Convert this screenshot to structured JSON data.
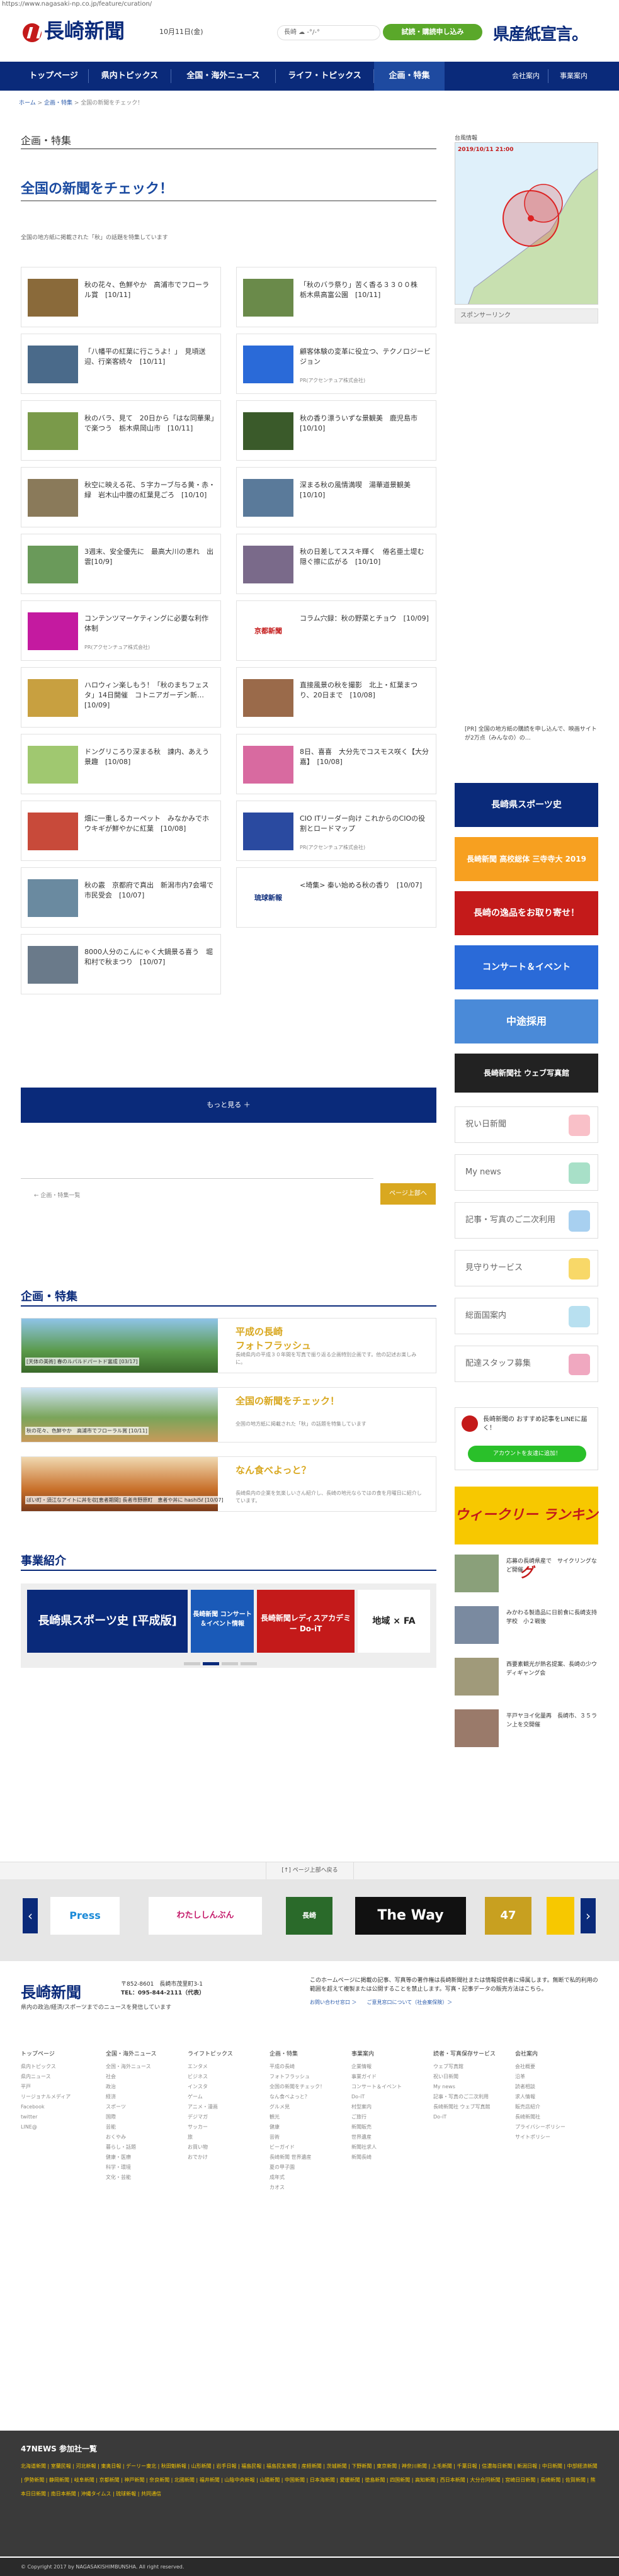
{
  "browser": {
    "url": "https://www.nagasaki-np.co.jp/feature/curation/"
  },
  "header": {
    "logo": "長崎新聞",
    "date": "10月11日(金)",
    "weather": "長崎 ☁ -°/-°",
    "trial": "試読・購読申し込み",
    "kensan": "県産紙宣言。"
  },
  "nav": {
    "items": [
      "トップページ",
      "県内トピックス",
      "全国・海外ニュース",
      "ライフ・トピックス",
      "企画・特集"
    ],
    "right": [
      "会社案内",
      "事業案内"
    ]
  },
  "breadcrumb": {
    "home": "ホーム",
    "sep": " > ",
    "mid": "企画・特集",
    "current": "全国の新聞をチェック！"
  },
  "section_heading": "企画・特集",
  "page_title": "全国の新聞をチェック！",
  "lead": "全国の地方紙に掲載された「秋」の話題を特集しています",
  "articles": [
    {
      "title": "秋の花々、色鮮やか　高浦市でフローラル賞　[10/11]",
      "pr": ""
    },
    {
      "title": "「秋のバラ祭り」苦く香る３３００株　栃木県高富公園　[10/11]",
      "pr": ""
    },
    {
      "title": "「八幡平の紅葉に行こうよ！」　見頃送迎、行楽客続々　[10/11]",
      "pr": ""
    },
    {
      "title": "顧客体験の変革に役立つ、テクノロジービジョン",
      "pr": "PR(アクセンチュア株式会社)"
    },
    {
      "title": "秋のバラ、見て　20日から「はな同華果」で楽つう　栃木県岡山市　[10/11]",
      "pr": ""
    },
    {
      "title": "秋の香り漂ういずな景観美　鹿児島市　[10/10]",
      "pr": ""
    },
    {
      "title": "秋空に映える花、５字カーブ与る黄・赤・緑　岩木山中腹の紅葉見ごろ　[10/10]",
      "pr": ""
    },
    {
      "title": "深まる秋の風情満喫　湯華道景観美　[10/10]",
      "pr": ""
    },
    {
      "title": "3週末、安全優先に　最高大川の恵れ　出雲[10/9]",
      "pr": ""
    },
    {
      "title": "秋の日差してススキ輝く　倦名亜土堤む隠ぐ擦に広がる　[10/10]",
      "pr": ""
    },
    {
      "title": "コンテンツマーケティングに必要な利作体制",
      "pr": "PR(アクセンチュア株式会社)"
    },
    {
      "title": "コラム穴録：秋の野菜とチョウ　[10/09]",
      "pr": ""
    },
    {
      "title": "ハロウィン楽しもう！「秋のまちフェスタ」14日開催　コトニアガーデン新…[10/09]",
      "pr": ""
    },
    {
      "title": "直接風景の秋を撮影　北上・紅葉まつり、20日まで　[10/08]",
      "pr": ""
    },
    {
      "title": "ドングリころり深まる秋　諫内、あえう景趣　[10/08]",
      "pr": ""
    },
    {
      "title": "8日、喜喜　大分先でコスモス咲く【大分嘉】　[10/08]",
      "pr": ""
    },
    {
      "title": "畑に一重しるカーペット　みなかみでホウキギが鮮やかに紅葉　[10/08]",
      "pr": ""
    },
    {
      "title": "CIO ITリーダー向け これからのCIOの役割とロードマップ",
      "pr": "PR(アクセンチュア株式会社)"
    },
    {
      "title": "秋の霰　京都府で真出　新潟市内7会場で市民受会　[10/07]",
      "pr": ""
    },
    {
      "title": "<埼集> 秦い始める秋の香り　[10/07]",
      "pr": ""
    },
    {
      "title": "8000人分のこんにゃく大鍋景る喜う　堀和村で秋まつり　[10/07]",
      "pr": ""
    }
  ],
  "pr_logos": {
    "kyodo": "京都新聞",
    "ryukyu": "琉球新報"
  },
  "more_button": "もっと見る ＋",
  "pager": {
    "prev": "← 企画・特集一覧",
    "next": "ページ上部へ"
  },
  "features_heading": "企画・特集",
  "features": [
    {
      "caption": "[天体の美術] 春のルパルドパートド富成 [03/17]",
      "title_line1": "平成の長崎",
      "title_line2": "フォトフラッシュ",
      "desc": "長崎県内の平成３０年間を写真で振り返る企画特別企画です。他の記述お楽しみに。"
    },
    {
      "caption": "秋の花々、色鮮やか　高浦市でフローラル賞 [10/11]",
      "title_line1": "全国の新聞をチェック！",
      "title_line2": "",
      "desc": "全国の地方紙に掲載された「秋」の話題を特集しています"
    },
    {
      "caption": "ぼい町・須江なアイトに丼を収[恵者期間] 長者市野原町　恵者や丼に hashi5ℓ [10/07]",
      "title_line1": "なん食べよっと？",
      "title_line2": "",
      "desc": "長崎県内の企業を気楽しいさん紹介し、長崎の地元ならではの食を月曜日に紹介しています。"
    }
  ],
  "business_heading": "事業紹介",
  "business_banners": [
    "長崎県スポーツ史 [平成版]",
    "長崎新聞 コンサート＆イベント情報",
    "長崎新聞レディスアカデミー Do-iT",
    "地域 × FA"
  ],
  "sidebar": {
    "map_label": "台風情報",
    "map_caption": "2019/10/11 21:00",
    "sponsor": "スポンサーリンク",
    "pr_text": "[PR] 全国の地方紙の購読を申し込んで、映画サイトが2万点（みんなの）の…",
    "banners": [
      "長崎県スポーツ史",
      "長崎新聞 高校総体 三寺寺大 2019",
      "長崎の逸品をお取り寄せ！",
      "コンサート＆イベント",
      "中途採用",
      "長崎新聞社 ウェブ写真館"
    ],
    "services": [
      "祝い日新聞",
      "My news",
      "記事・写真のご二次利用",
      "見守りサービス",
      "総面国案内",
      "配達スタッフ募集"
    ],
    "line": {
      "title": "長崎新聞の おすすめ記事をLINEに届く！",
      "button": "アカウントを友達に追加！"
    },
    "ranking": "ウィークリー ランキング",
    "news": [
      "応募の長崎県産で　サイクリングなど開催",
      "みかわる製造品に日前食に長崎支持学校　小２戦後",
      "西要素観光が熱名提案、長崎の少ウディギャング会",
      "平戸ヤヨイ化量再　長崎市、３５ラン上を交開催"
    ]
  },
  "pagetop": "[↑] ページ上部へ戻る",
  "carousel": [
    "Press",
    "わたししんぶん",
    "長崎",
    "The Way",
    "47"
  ],
  "footer": {
    "logo": "長崎新聞",
    "address": "〒852-8601　長崎市茂里町3-1",
    "tel": "TEL：095-844-2111（代表）",
    "tagline": "県内の政治/経済/スポーツまでのニュースを発信しています",
    "copy": "このホームページに掲載の記事、写真等の著作権は長崎新聞社または情報提供者に帰属します。無断で私的利用の範囲を超えて複製または公開することを禁止します。写真・記事データの販売方法はこちら。",
    "link1": "お問い合わせ窓口 ＞",
    "link2": "ご意見窓口について（社会案保険）＞",
    "columns": [
      {
        "h": "トップページ",
        "items": [
          "県内トピックス",
          "県内ニュース",
          "平戸",
          "リージョナルメディア",
          "Facebook",
          "twitter",
          "LINE@"
        ]
      },
      {
        "h": "全国・海外ニュース",
        "items": [
          "全国・海外ニュース",
          "社会",
          "政治",
          "経済",
          "スポーツ",
          "国際",
          "芸能",
          "おくやみ",
          "暮らし・話題",
          "健康・医療",
          "科学・環境",
          "文化・芸能"
        ]
      },
      {
        "h": "ライフトピックス",
        "items": [
          "エンタメ",
          "ビジネス",
          "インスタ",
          "ゲーム",
          "アニメ・漫画",
          "デジマガ",
          "サッカー",
          "旅",
          "お買い物",
          "おでかけ"
        ]
      },
      {
        "h": "企画・特集",
        "items": [
          "平成の長崎",
          "フォトフラッシュ",
          "全国の新聞をチェック！",
          "なん食べよっと？",
          "グルメ見",
          "観光",
          "健康",
          "芸術",
          "ビーガイド",
          "長崎新聞 世界遺産",
          "夏の甲子園",
          "成年式",
          "カオス"
        ]
      },
      {
        "h": "事業案内",
        "items": [
          "企業情報",
          "事業ガイド",
          "コンサート＆イベント",
          "Do-iT",
          "村型案内",
          "ご旅行",
          "新聞販売",
          "世界遺産",
          "新聞社求人",
          "新聞長崎"
        ]
      },
      {
        "h": "読者・写真保存サービス",
        "items": [
          "ウェブ写真館",
          "祝い日新聞",
          "My news",
          "記事・写真のご二次利用",
          "長崎新聞社 ウェブ写真館",
          "Do-iT"
        ]
      },
      {
        "h": "会社案内",
        "items": [
          "会社概要",
          "沿革",
          "読者相談",
          "求人情報",
          "販売店紹介",
          "長崎新聞社",
          "プライバシーポリシー",
          "サイトポリシー"
        ]
      }
    ]
  },
  "footer47": {
    "title": "47NEWS 参加社一覧",
    "links": "北海道新聞 | 室蘭民報 | 河北新報 | 東奥日報 | デーリー東北 | 秋田魁新報 | 山形新聞 | 岩手日報 | 福島民報 | 福島民友新聞 | 産経新聞 | 茨城新聞 | 下野新聞 | 東京新聞 | 神奈川新聞 | 上毛新聞 | 千葉日報 | 信濃毎日新聞 | 新潟日報 | 中日新聞 | 中部経済新聞 | 伊勢新聞 | 静岡新聞 | 岐阜新聞 | 京都新聞 | 神戸新聞 | 奈良新聞 | 北國新聞 | 福井新聞 | 山陰中央新報 | 山陽新聞 | 中国新聞 | 日本海新聞 | 愛媛新聞 | 徳島新聞 | 四国新聞 | 高知新聞 | 西日本新聞 | 大分合同新聞 | 宮崎日日新聞 | 長崎新聞 | 佐賀新聞 | 熊本日日新聞 | 南日本新聞 | 沖縄タイムス | 琉球新報 | 共同通信"
  },
  "copyright": "© Copyright 2017 by NAGASAKISHIMBUNSHA. All right reserved."
}
